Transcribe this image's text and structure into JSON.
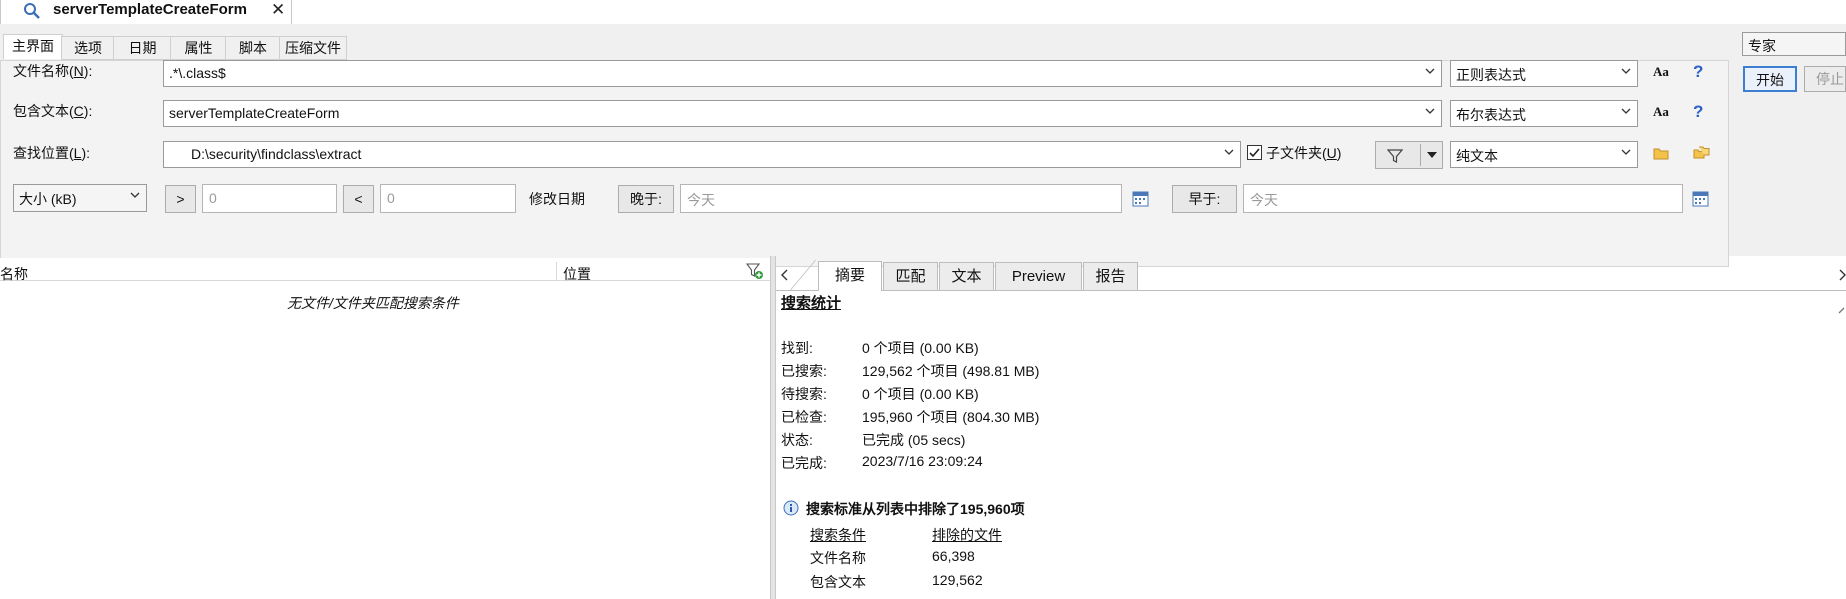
{
  "doc_tab": {
    "title": "serverTemplateCreateForm",
    "close": "✕"
  },
  "mode_select": {
    "value": "专家"
  },
  "start_button": "开始",
  "stop_button": "停止",
  "tabs": [
    "主界面",
    "选项",
    "日期",
    "属性",
    "脚本",
    "压缩文件"
  ],
  "filename": {
    "label": "文件名称(N):",
    "label_pre": "文件名称(",
    "label_key": "N",
    "label_post": "):",
    "value": ".*\\.class$",
    "mode": "正则表达式"
  },
  "contains": {
    "label": "包含文本(C):",
    "label_pre": "包含文本(",
    "label_key": "C",
    "label_post": "):",
    "value": "serverTemplateCreateForm",
    "mode": "布尔表达式"
  },
  "location": {
    "label": "查找位置(L):",
    "label_pre": "查找位置(",
    "label_key": "L",
    "label_post": "):",
    "value": "D:\\security\\findclass\\extract",
    "subfolder_pre": "子文件夹(",
    "subfolder_key": "U",
    "subfolder_post": ")",
    "subfolder_checked": true,
    "mode": "纯文本"
  },
  "size": {
    "unit": "大小 (kB)",
    "gt": ">",
    "gt_value": "0",
    "lt": "<",
    "lt_value": "0"
  },
  "date": {
    "label": "修改日期",
    "after_btn": "晚于:",
    "after_ph": "今天",
    "before_btn": "早于:",
    "before_ph": "今天"
  },
  "results": {
    "col_name": "名称",
    "col_location": "位置",
    "empty": "无文件/文件夹匹配搜索条件"
  },
  "right_tabs": [
    "摘要",
    "匹配",
    "文本",
    "Preview",
    "报告"
  ],
  "summary": {
    "heading": "搜索统计",
    "rows": [
      {
        "k": "找到:",
        "v": "0 个项目  (0.00 KB)"
      },
      {
        "k": "已搜索:",
        "v": "129,562 个项目  (498.81 MB)"
      },
      {
        "k": "待搜索:",
        "v": "0 个项目  (0.00 KB)"
      },
      {
        "k": "已检查:",
        "v": "195,960 个项目  (804.30 MB)"
      },
      {
        "k": "状态:",
        "v": "已完成  (05 secs)"
      },
      {
        "k": "已完成:",
        "v": "2023/7/16 23:09:24"
      }
    ],
    "excluded_title": "搜索标准从列表中排除了195,960项",
    "criteria_header": "搜索条件",
    "excluded_header": "排除的文件",
    "excluded_rows": [
      {
        "k": "文件名称",
        "v": "66,398"
      },
      {
        "k": "包含文本",
        "v": "129,562"
      }
    ]
  }
}
